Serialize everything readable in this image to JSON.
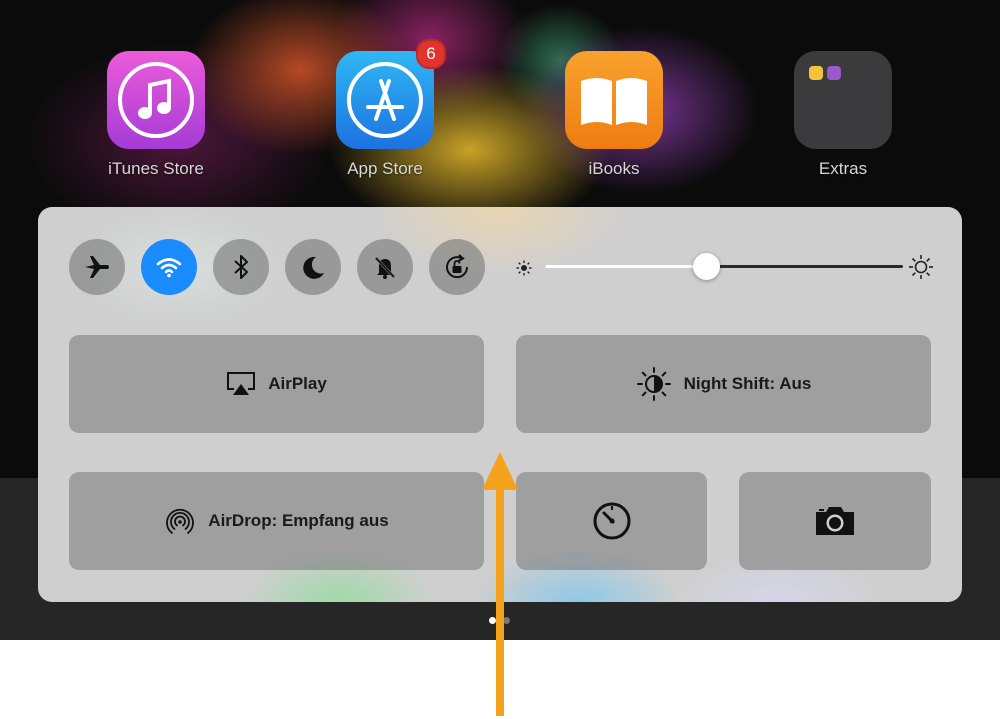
{
  "home_screen": {
    "apps": [
      {
        "label": "iTunes Store",
        "icon": "itunes-note-icon"
      },
      {
        "label": "App Store",
        "icon": "app-store-icon",
        "badge": "6"
      },
      {
        "label": "iBooks",
        "icon": "open-book-icon"
      },
      {
        "label": "Extras",
        "icon": "folder-icon"
      }
    ],
    "page_indicator": {
      "pages": 2,
      "current": 1
    }
  },
  "control_center": {
    "toggles": [
      {
        "name": "airplane-mode",
        "icon": "airplane-icon",
        "on": false
      },
      {
        "name": "wifi",
        "icon": "wifi-icon",
        "on": true
      },
      {
        "name": "bluetooth",
        "icon": "bluetooth-icon",
        "on": false
      },
      {
        "name": "do-not-disturb",
        "icon": "moon-icon",
        "on": false
      },
      {
        "name": "mute",
        "icon": "bell-slash-icon",
        "on": false
      },
      {
        "name": "rotation-lock",
        "icon": "rotation-lock-icon",
        "on": false
      }
    ],
    "brightness": {
      "level": 0.45
    },
    "airplay_label": "AirPlay",
    "night_shift_label": "Night Shift: Aus",
    "airdrop_label": "AirDrop: Empfang aus"
  },
  "colors": {
    "accent_on": "#1a8cff",
    "annotation_arrow": "#f7a21c",
    "badge": "#e0342d"
  }
}
